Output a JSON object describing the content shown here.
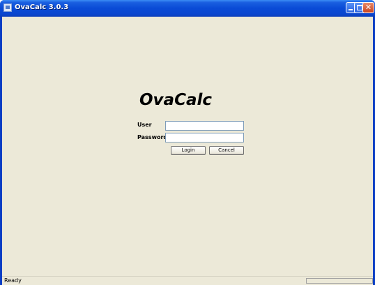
{
  "window": {
    "title": "OvaCalc 3.0.3",
    "icons": {
      "app": "app-window-icon",
      "minimize": "minimize-icon",
      "maximize": "maximize-icon",
      "close": "close-icon"
    },
    "colors": {
      "titlebar": "#0a4bd6",
      "close_button": "#c9431f",
      "client_background": "#ece9d8"
    }
  },
  "login": {
    "logo_text": "OvaCalc",
    "user_label": "User",
    "user_value": "",
    "password_label": "Password",
    "password_value": "",
    "login_button": "Login",
    "cancel_button": "Cancel"
  },
  "status": {
    "text": "Ready",
    "progress": 0
  }
}
